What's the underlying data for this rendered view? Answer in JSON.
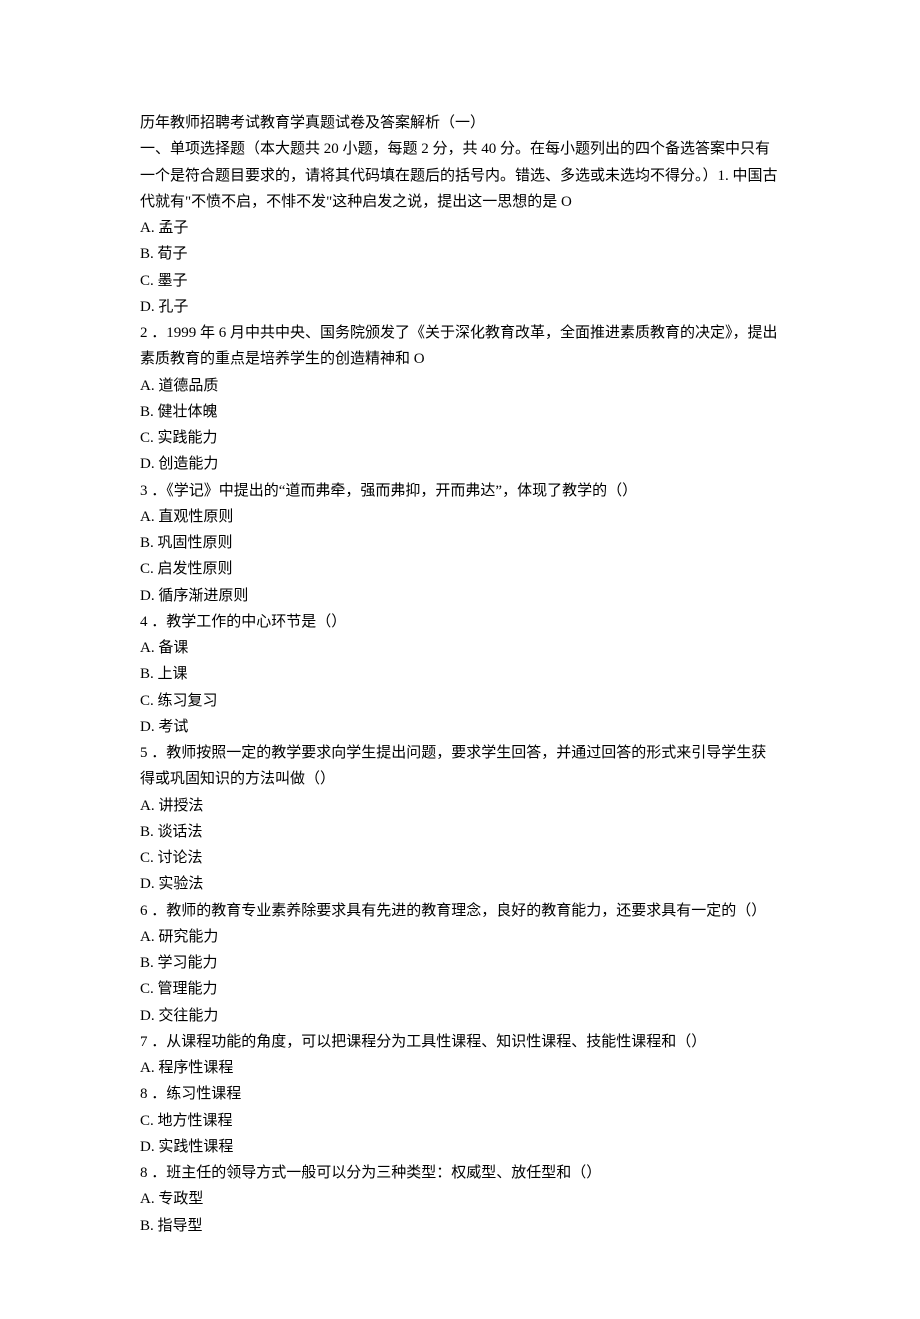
{
  "title": "历年教师招聘考试教育学真题试卷及答案解析（一）",
  "section_intro": "一、单项选择题（本大题共 20 小题，每题 2 分，共 40 分。在每小题列出的四个备选答案中只有一个是符合题目要求的，请将其代码填在题后的括号内。错选、多选或未选均不得分。）1. 中国古代就有\"不愤不启，不悱不发\"这种启发之说，提出这一思想的是 O",
  "q1": {
    "a": "A. 孟子",
    "b": "B. 荀子",
    "c": "C. 墨子",
    "d": "D. 孔子"
  },
  "q2": {
    "stem": "2 ．1999 年 6 月中共中央、国务院颁发了《关于深化教育改革，全面推进素质教育的决定》，提出素质教育的重点是培养学生的创造精神和 O",
    "a": "A. 道德品质",
    "b": "B. 健壮体魄",
    "c": "C. 实践能力",
    "d": "D. 创造能力"
  },
  "q3": {
    "stem": "3 ．《学记》中提出的“道而弗牵，强而弗抑，开而弗达”，体现了教学的（）",
    "a": "A. 直观性原则",
    "b": "B. 巩固性原则",
    "c": "C. 启发性原则",
    "d": "D. 循序渐进原则"
  },
  "q4": {
    "stem": "4 ．教学工作的中心环节是（）",
    "a": "A. 备课",
    "b": "B. 上课",
    "c": "C. 练习复习",
    "d": "D. 考试"
  },
  "q5": {
    "stem": "5 ．教师按照一定的教学要求向学生提出问题，要求学生回答，并通过回答的形式来引导学生获得或巩固知识的方法叫做（）",
    "a": "A. 讲授法",
    "b": "B. 谈话法",
    "c": "C. 讨论法",
    "d": "D. 实验法"
  },
  "q6": {
    "stem": "6 ．教师的教育专业素养除要求具有先进的教育理念，良好的教育能力，还要求具有一定的（）",
    "a": "A. 研究能力",
    "b": "B. 学习能力",
    "c": "C. 管理能力",
    "d": "D. 交往能力"
  },
  "q7": {
    "stem": "7 ．从课程功能的角度，可以把课程分为工具性课程、知识性课程、技能性课程和（）",
    "a": "A. 程序性课程",
    "b": "8 ．练习性课程",
    "c": "C. 地方性课程",
    "d": "D. 实践性课程"
  },
  "q8": {
    "stem": "8 ．班主任的领导方式一般可以分为三种类型：权威型、放任型和（）",
    "a": "A. 专政型",
    "b": "B. 指导型"
  }
}
